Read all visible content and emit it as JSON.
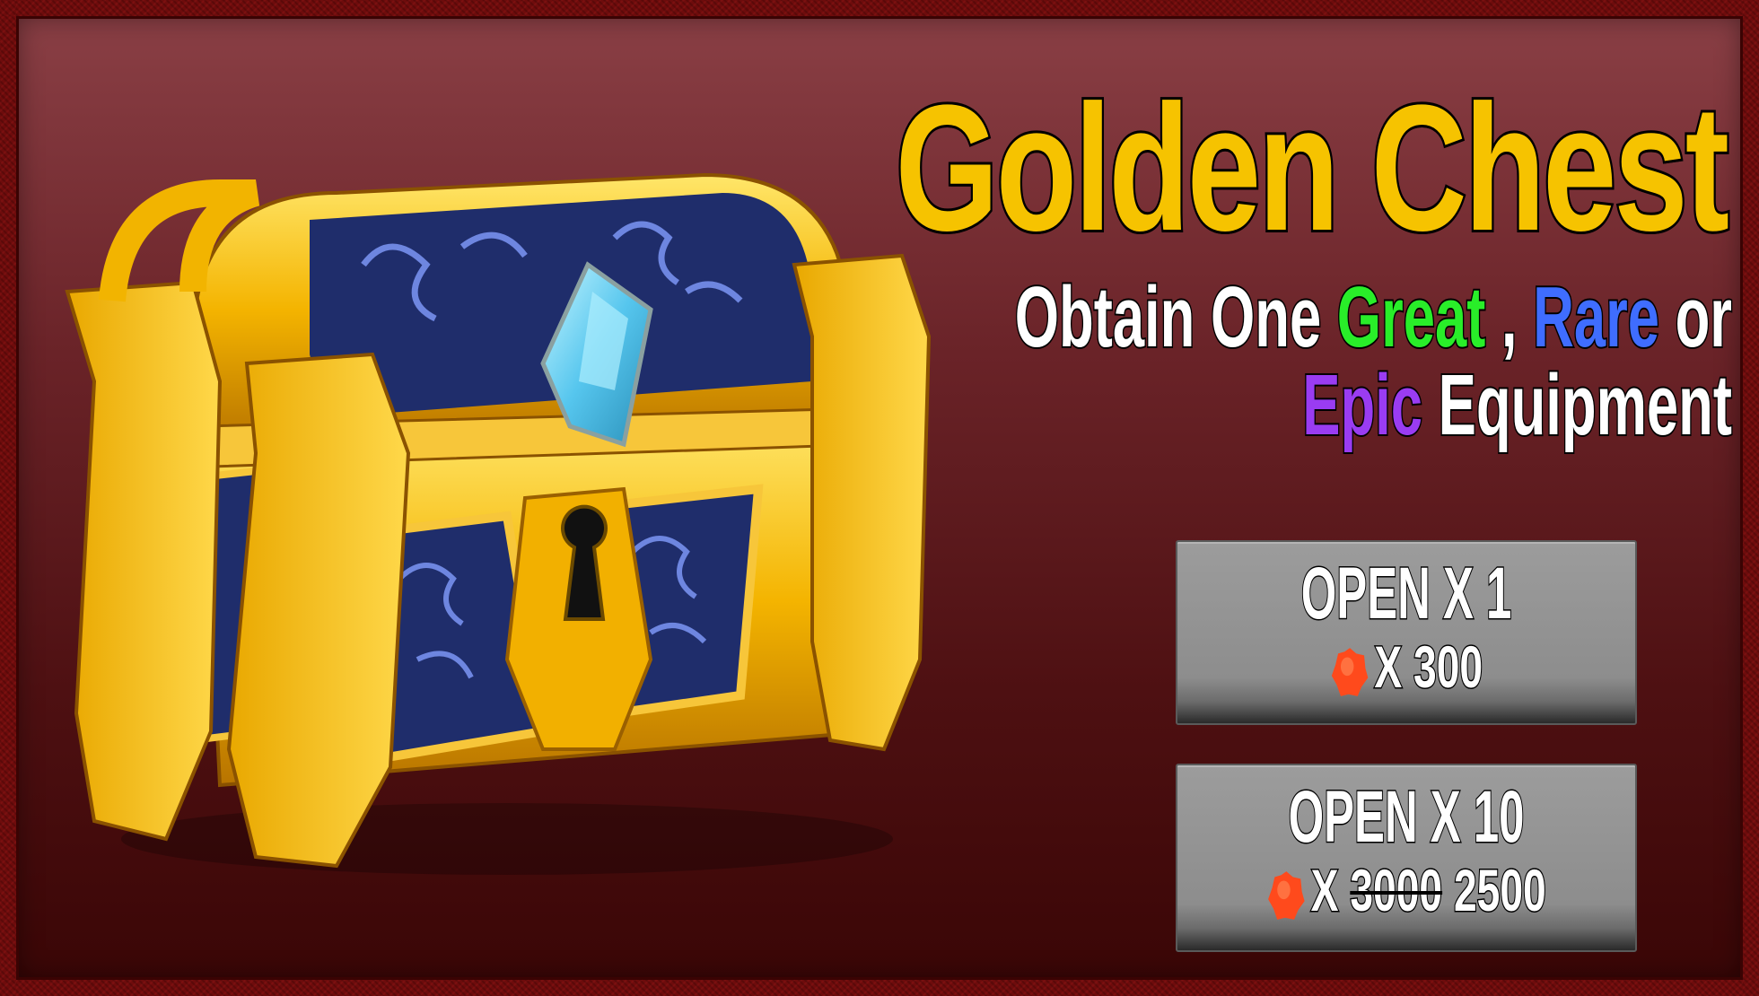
{
  "title": "Golden Chest",
  "subtitle": {
    "prefix": "Obtain One",
    "great": "Great",
    "sep": " ,",
    "rare": "Rare",
    "or": "or",
    "epic": "Epic",
    "suffix": "Equipment"
  },
  "buttons": [
    {
      "label": "OPEN X 1",
      "cost_prefix": "X",
      "cost": "300"
    },
    {
      "label": "OPEN X 10",
      "cost_prefix": "X",
      "old_cost": "3000",
      "cost": "2500"
    }
  ],
  "colors": {
    "title": "#f6c300",
    "great": "#29ee29",
    "rare": "#3f6dff",
    "epic": "#9a3cf2",
    "gem": "#ff4a1c"
  },
  "icons": {
    "currency": "red-gem-icon",
    "chest": "golden-chest-icon"
  }
}
